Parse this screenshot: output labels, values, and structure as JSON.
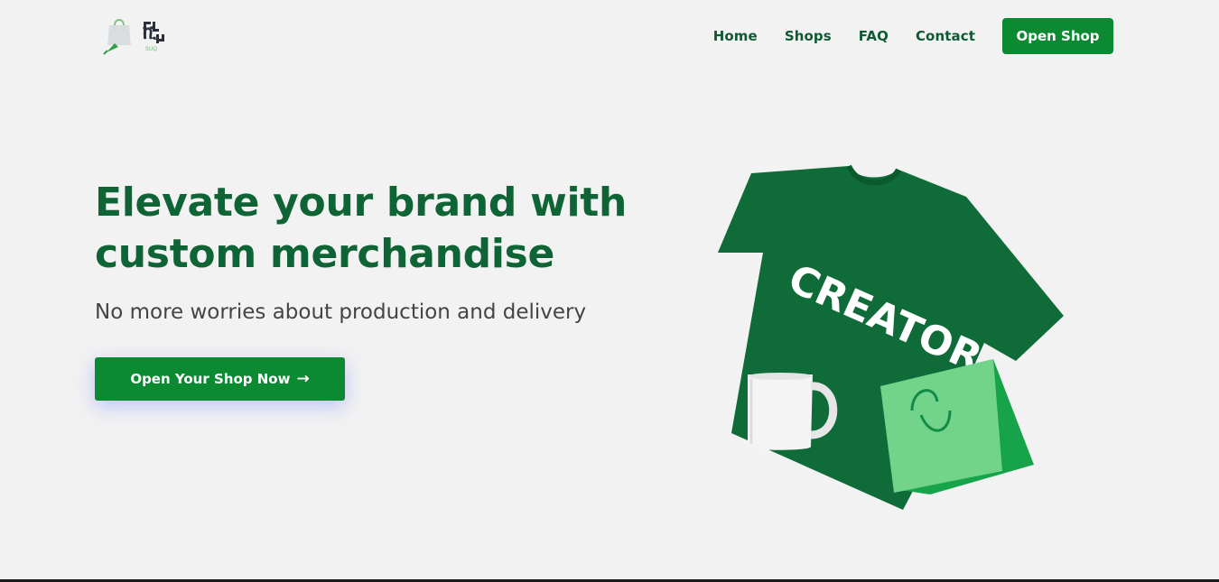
{
  "header": {
    "logo_icon": "shopping-bag-rocket-icon",
    "logo_subtext": "SUQ",
    "nav": [
      {
        "label": "Home"
      },
      {
        "label": "Shops"
      },
      {
        "label": "FAQ"
      },
      {
        "label": "Contact"
      }
    ],
    "open_shop_label": "Open Shop"
  },
  "hero": {
    "title": "Elevate your brand with custom merchandise",
    "subtitle": "No more worries about production and delivery",
    "cta_label": "Open Your Shop Now",
    "cta_icon": "arrow-right-icon",
    "image": {
      "shirt_text": "CREATOR",
      "items": [
        "t-shirt",
        "mug",
        "shopping-bag"
      ]
    }
  },
  "colors": {
    "primary": "#0b8a31",
    "heading": "#0f6436",
    "background": "#f2f2f2"
  }
}
